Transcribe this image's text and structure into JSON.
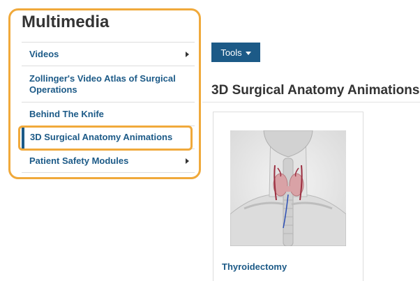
{
  "sidebar": {
    "title": "Multimedia",
    "items": [
      {
        "label": "Videos",
        "has_children": true,
        "active": false
      },
      {
        "label": "Zollinger's Video Atlas of Surgical Operations",
        "has_children": false,
        "active": false
      },
      {
        "label": "Behind The Knife",
        "has_children": false,
        "active": false
      },
      {
        "label": "3D Surgical Anatomy Animations",
        "has_children": false,
        "active": true
      },
      {
        "label": "Patient Safety Modules",
        "has_children": true,
        "active": false
      }
    ]
  },
  "main": {
    "tools_label": "Tools",
    "section_title": "3D Surgical Anatomy Animations",
    "cards": [
      {
        "label": "Thyroidectomy",
        "image_icon": "neck-anatomy-thyroid-illustration"
      }
    ]
  },
  "colors": {
    "accent": "#1c5a87",
    "highlight": "#f0a93b",
    "text": "#333333",
    "border": "#dddddd"
  }
}
